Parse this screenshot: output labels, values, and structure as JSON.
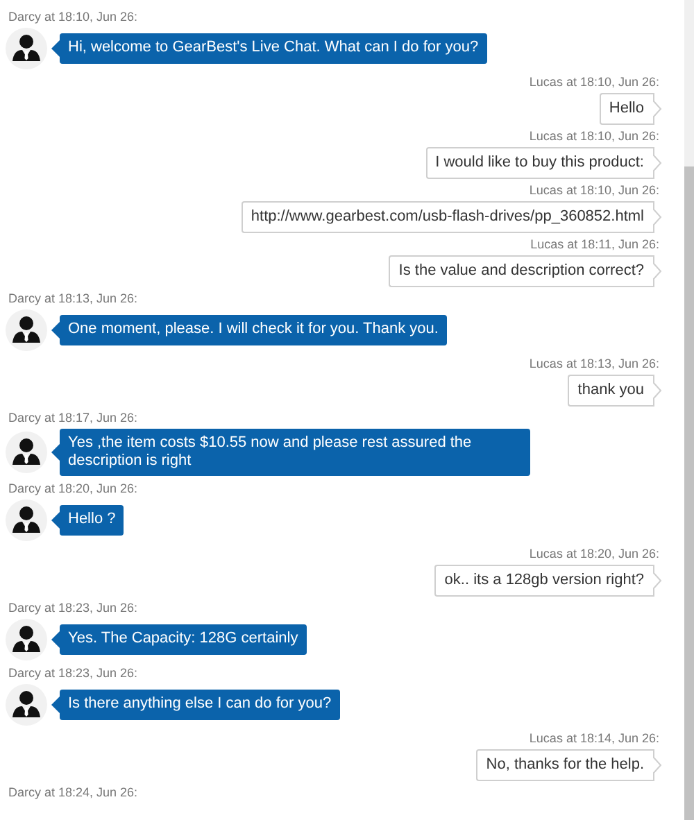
{
  "messages": [
    {
      "kind": "agent",
      "header": "Darcy at 18:10, Jun 26:",
      "text": "Hi, welcome to GearBest's Live Chat. What can I do for you?"
    },
    {
      "kind": "user",
      "header": "Lucas at 18:10, Jun 26:",
      "text": "Hello"
    },
    {
      "kind": "user",
      "header": "Lucas at 18:10, Jun 26:",
      "text": "I would like to buy this product:"
    },
    {
      "kind": "user",
      "header": "Lucas at 18:10, Jun 26:",
      "text": "http://www.gearbest.com/usb-flash-drives/pp_360852.html"
    },
    {
      "kind": "user",
      "header": "Lucas at 18:11, Jun 26:",
      "text": "Is the value and description correct?"
    },
    {
      "kind": "agent",
      "header": "Darcy at 18:13, Jun 26:",
      "text": "One moment, please. I will check it for you. Thank you."
    },
    {
      "kind": "user",
      "header": "Lucas at 18:13, Jun 26:",
      "text": "thank you"
    },
    {
      "kind": "agent",
      "header": "Darcy at 18:17, Jun 26:",
      "text": "Yes ,the item costs $10.55 now and please rest assured the description is right"
    },
    {
      "kind": "agent",
      "header": "Darcy at 18:20, Jun 26:",
      "text": "Hello ?"
    },
    {
      "kind": "user",
      "header": "Lucas at 18:20, Jun 26:",
      "text": "ok.. its a 128gb version right?"
    },
    {
      "kind": "agent",
      "header": "Darcy at 18:23, Jun 26:",
      "text": "Yes. The Capacity: 128G certainly"
    },
    {
      "kind": "agent",
      "header": "Darcy at 18:23, Jun 26:",
      "text": "Is there anything else I can do for you?"
    },
    {
      "kind": "user",
      "header": "Lucas at 18:14, Jun 26:",
      "text": "No, thanks for the help."
    },
    {
      "kind": "agent",
      "header": "Darcy at 18:24, Jun 26:"
    }
  ]
}
